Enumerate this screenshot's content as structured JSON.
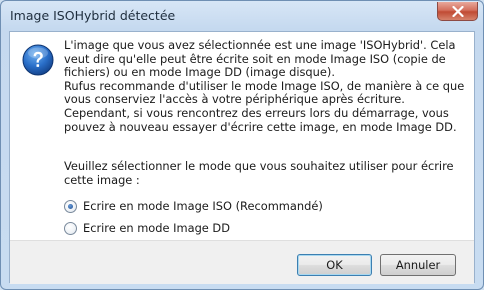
{
  "window": {
    "title": "Image ISOHybrid détectée"
  },
  "icons": {
    "dialog": "question-icon",
    "close": "close-icon"
  },
  "message": {
    "lines": [
      "L'image que vous avez sélectionnée est une image 'ISOHybrid'. Cela veut dire qu'elle peut être écrite soit en mode Image ISO (copie de fichiers) ou en mode Image DD (image disque).",
      "Rufus recommande d'utiliser le mode Image ISO, de manière à ce que vous conserviez l'accès à votre périphérique après écriture.",
      "Cependant, si vous rencontrez des erreurs lors du démarrage, vous pouvez à nouveau essayer d'écrire cette image, en mode Image DD."
    ],
    "prompt": "Veuillez sélectionner le mode que vous souhaitez utiliser pour écrire cette image :"
  },
  "options": [
    {
      "label": "Ecrire en mode Image ISO (Recommandé)",
      "selected": true
    },
    {
      "label": "Ecrire en mode Image DD",
      "selected": false
    }
  ],
  "buttons": {
    "ok": "OK",
    "cancel": "Annuler"
  }
}
